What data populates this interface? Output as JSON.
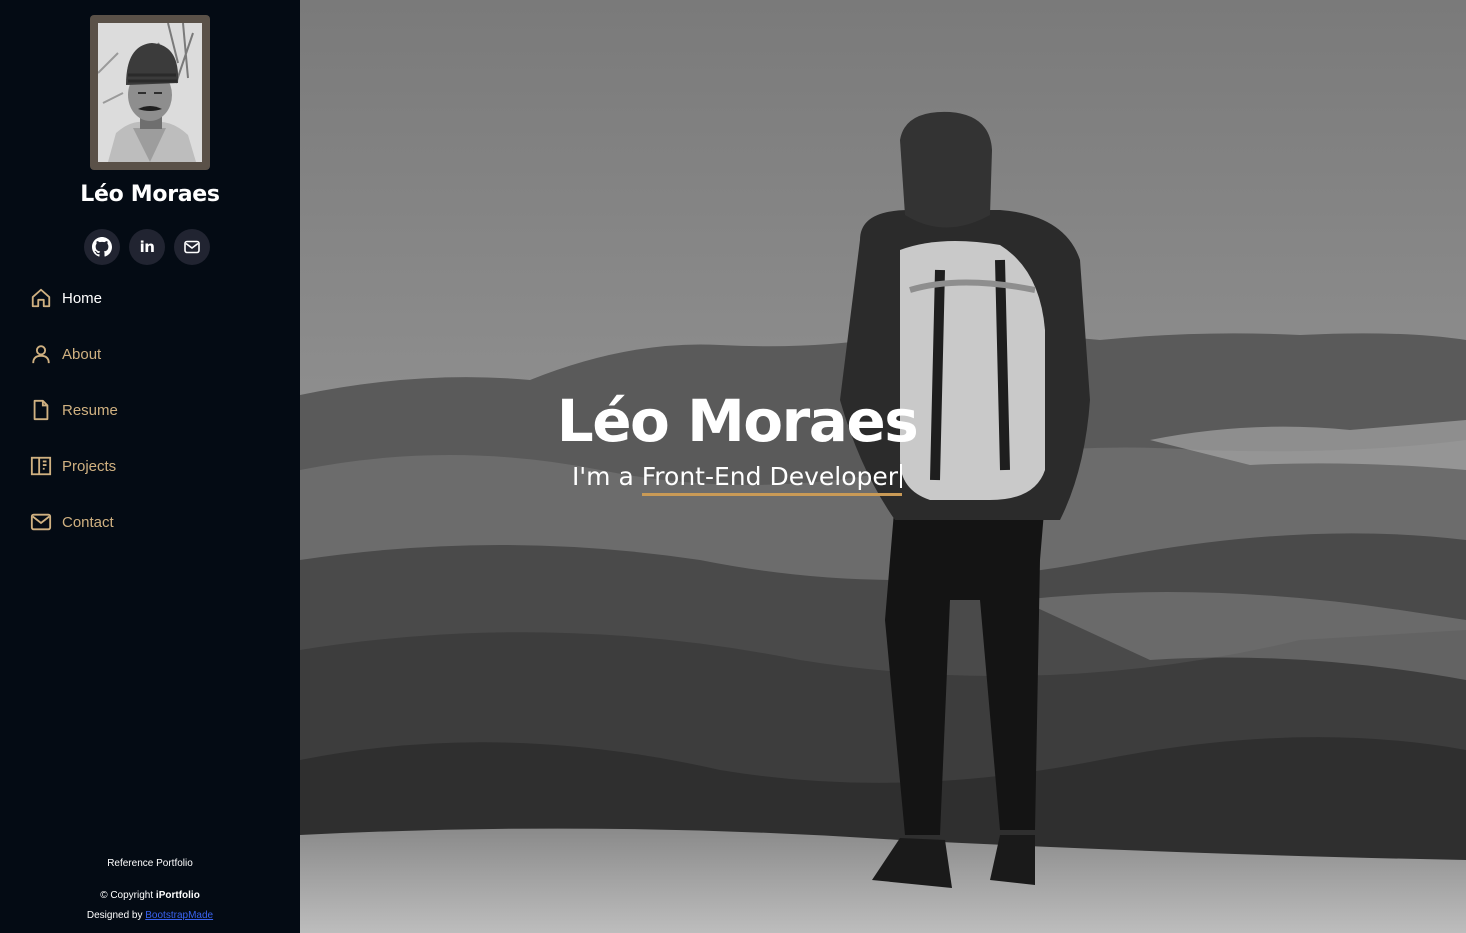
{
  "profile": {
    "name": "Léo Moraes"
  },
  "social": [
    {
      "id": "github",
      "icon": "github-icon"
    },
    {
      "id": "linkedin",
      "icon": "linkedin-icon",
      "text": "in"
    },
    {
      "id": "email",
      "icon": "mail-icon"
    }
  ],
  "nav": {
    "items": [
      {
        "label": "Home",
        "icon": "home-icon",
        "active": true
      },
      {
        "label": "About",
        "icon": "user-icon",
        "active": false
      },
      {
        "label": "Resume",
        "icon": "file-icon",
        "active": false
      },
      {
        "label": "Projects",
        "icon": "layout-icon",
        "active": false
      },
      {
        "label": "Contact",
        "icon": "envelope-icon",
        "active": false
      }
    ]
  },
  "footer": {
    "reference": "Reference Portfolio",
    "copyright_prefix": "© Copyright ",
    "copyright_brand": "iPortfolio",
    "designed_prefix": "Designed by ",
    "designed_link": "BootstrapMade"
  },
  "hero": {
    "name": "Léo Moraes",
    "prefix": "I'm a ",
    "typed": "Front-End Developer"
  },
  "colors": {
    "sidebar_bg": "#040b14",
    "accent": "#d0b181",
    "underline": "#c99a56",
    "social_bg": "#212431",
    "link": "#3a63f0"
  }
}
